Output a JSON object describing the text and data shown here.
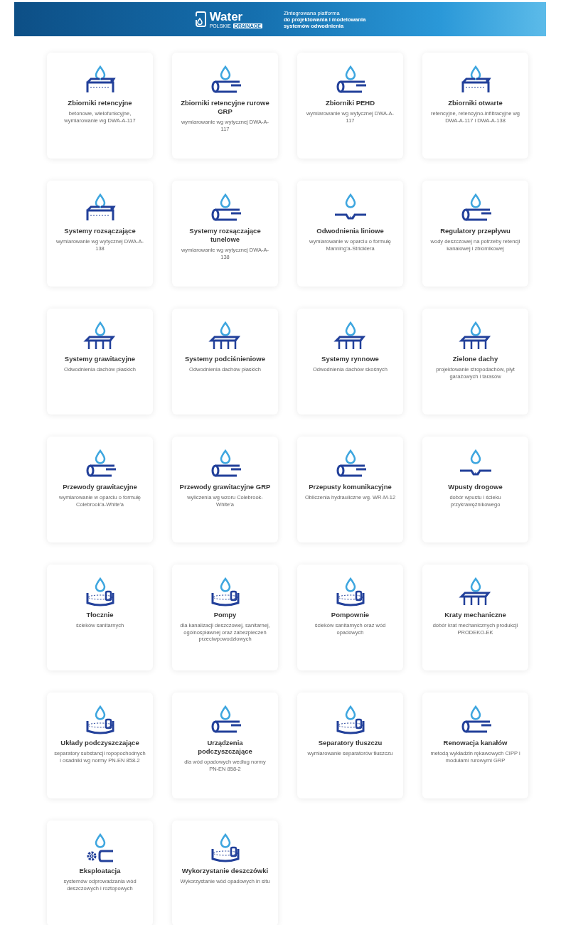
{
  "header": {
    "logo_text": "Water",
    "logo_subtext": "POLSKIE",
    "logo_badge": "DRAINAGE",
    "tagline": [
      {
        "text": "Zintegrowana platforma",
        "bold": false
      },
      {
        "text": "do projektowania i modelowania",
        "bold": true
      },
      {
        "text": "systemów odwodnienia",
        "bold": true
      }
    ]
  },
  "cards": [
    {
      "title": "Zbiorniki retencyjne",
      "description": "betonowe, wielofunkcyjne, wymiarowanie wg DWA-A-117"
    },
    {
      "title": "Zbiorniki retencyjne rurowe GRP",
      "description": "wymiarowanie wg wytycznej DWA-A-117"
    },
    {
      "title": "Zbiorniki PEHD",
      "description": "wymiarowanie wg wytycznej DWA-A-117"
    },
    {
      "title": "Zbiorniki otwarte",
      "description": "retencyjne, retencyjno-infiltracyjne wg DWA-A-117 i DWA-A-138"
    },
    {
      "title": "Systemy rozsączające",
      "description": "wymiarowanie wg wytycznej DWA-A-138"
    },
    {
      "title": "Systemy rozsączające tunelowe",
      "description": "wymiarowanie wg wytycznej DWA-A-138"
    },
    {
      "title": "Odwodnienia liniowe",
      "description": "wymiarowanie w oparciu o formułę Manning'a-Stricklera"
    },
    {
      "title": "Regulatory przepływu",
      "description": "wody deszczowej na potrzeby retencji kanałowej i zbiornikowej"
    },
    {
      "title": "Systemy grawitacyjne",
      "description": "Odwodnienia dachów płaskich"
    },
    {
      "title": "Systemy podciśnieniowe",
      "description": "Odwodnienia dachów płaskich"
    },
    {
      "title": "Systemy rynnowe",
      "description": "Odwodnienia dachów skośnych"
    },
    {
      "title": "Zielone dachy",
      "description": "projektowanie stropodachów, płyt garażowych i tarasów"
    },
    {
      "title": "Przewody grawitacyjne",
      "description": "wymiarowanie w oparciu o formułę Colebrook'a-White'a"
    },
    {
      "title": "Przewody grawitacyjne GRP",
      "description": "wyliczenia wg wzoru Colebrook-White'a"
    },
    {
      "title": "Przepusty komunikacyjne",
      "description": "Obliczenia hydrauliczne wg. WR-M-12"
    },
    {
      "title": "Wpusty drogowe",
      "description": "dobór wpustu i ścieku przykrawężnikowego"
    },
    {
      "title": "Tłocznie",
      "description": "ścieków sanitarnych"
    },
    {
      "title": "Pompy",
      "description": "dla kanalizacji deszczowej, sanitarnej, ogólnospławnej oraz zabezpieczeń przeciwpowodziowych"
    },
    {
      "title": "Pompownie",
      "description": "ścieków sanitarnych oraz wód opadowych"
    },
    {
      "title": "Kraty mechaniczne",
      "description": "dobór krat mechanicznych produkcji PRODEKO-EK"
    },
    {
      "title": "Układy podczyszczające",
      "description": "separatory substancji ropopochodnych i osadniki wg normy PN-EN 858-2"
    },
    {
      "title": "Urządzenia podczyszczające",
      "description": "dla wód opadowych według normy PN-EN 858-2"
    },
    {
      "title": "Separatory tłuszczu",
      "description": "wymiarowanie separatorów tłuszczu"
    },
    {
      "title": "Renowacja kanałów",
      "description": "metodą wykładzin rękawowych CIPP i modułami rurowymi GRP"
    },
    {
      "title": "Eksploatacja",
      "description": "systemów odprowadzania wód deszczowych i roztopowych"
    },
    {
      "title": "Wykorzystanie deszczówki",
      "description": "Wykorzystanie wód opadowych in situ"
    }
  ]
}
